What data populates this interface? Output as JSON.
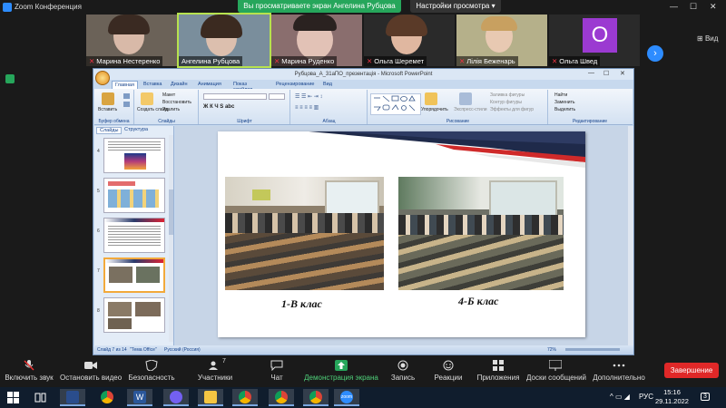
{
  "app": {
    "title": "Zoom Конференция"
  },
  "banner": {
    "share_text": "Вы просматриваете экран Ангелина Рубцова",
    "view_settings": "Настройки просмотра"
  },
  "view": {
    "label": "Вид"
  },
  "participants": [
    {
      "name": "Марина Нестеренко"
    },
    {
      "name": "Ангелина Рубцова"
    },
    {
      "name": "Марина Руденко"
    },
    {
      "name": "Ольга Шеремет"
    },
    {
      "name": "Лілія Беженарь"
    },
    {
      "name": "Ольга Швед",
      "initial": "O"
    }
  ],
  "ppt": {
    "title": "Рубцова_А_31аПО_презентація - Microsoft PowerPoint",
    "tabs": [
      "Главная",
      "Вставка",
      "Дизайн",
      "Анимация",
      "Показ слайдов",
      "Рецензирование",
      "Вид"
    ],
    "groups": [
      "Буфер обмена",
      "Слайды",
      "Шрифт",
      "Абзац",
      "Рисование",
      "Редактирование"
    ],
    "buttons": {
      "paste": "Вставить",
      "new_slide": "Создать слайд",
      "layout": "Макет",
      "reset": "Восстановить",
      "delete": "Удалить",
      "arrange": "Упорядочить",
      "quick_styles": "Экспресс-стили",
      "fill": "Заливка фигуры",
      "outline": "Контур фигуры",
      "effects": "Эффекты для фигур",
      "find": "Найти",
      "replace": "Заменить",
      "select": "Выделить"
    },
    "panel_tabs": [
      "Слайды",
      "Структура"
    ],
    "thumb_numbers": [
      "4",
      "5",
      "6",
      "7",
      "8"
    ],
    "slide": {
      "caption_left": "1-В клас",
      "caption_right": "4-Б клас"
    },
    "status": {
      "slide": "Слайд 7 из 14",
      "theme": "\"Тема Office\"",
      "lang": "Русский (Россия)",
      "zoom": "72%"
    }
  },
  "toolbar": [
    {
      "label": "Включить звук",
      "icon": "mic-muted-icon"
    },
    {
      "label": "Остановить видео",
      "icon": "video-icon"
    },
    {
      "label": "Безопасность",
      "icon": "shield-icon"
    },
    {
      "label": "Участники",
      "icon": "participants-icon",
      "count": "7"
    },
    {
      "label": "Чат",
      "icon": "chat-icon"
    },
    {
      "label": "Демонстрация экрана",
      "icon": "share-screen-icon"
    },
    {
      "label": "Запись",
      "icon": "record-icon"
    },
    {
      "label": "Реакции",
      "icon": "reactions-icon"
    },
    {
      "label": "Приложения",
      "icon": "apps-icon"
    },
    {
      "label": "Доски сообщений",
      "icon": "whiteboard-icon"
    },
    {
      "label": "Дополнительно",
      "icon": "more-icon"
    }
  ],
  "end_button": "Завершение",
  "taskbar": {
    "lang": "РУС",
    "time": "15:16",
    "date": "29.11.2022",
    "notifications": "3"
  },
  "colors": {
    "share_green": "#26a65b",
    "zoom_blue": "#2d8cff",
    "end_red": "#e02828",
    "avatar_purple": "#9b3ad1"
  }
}
